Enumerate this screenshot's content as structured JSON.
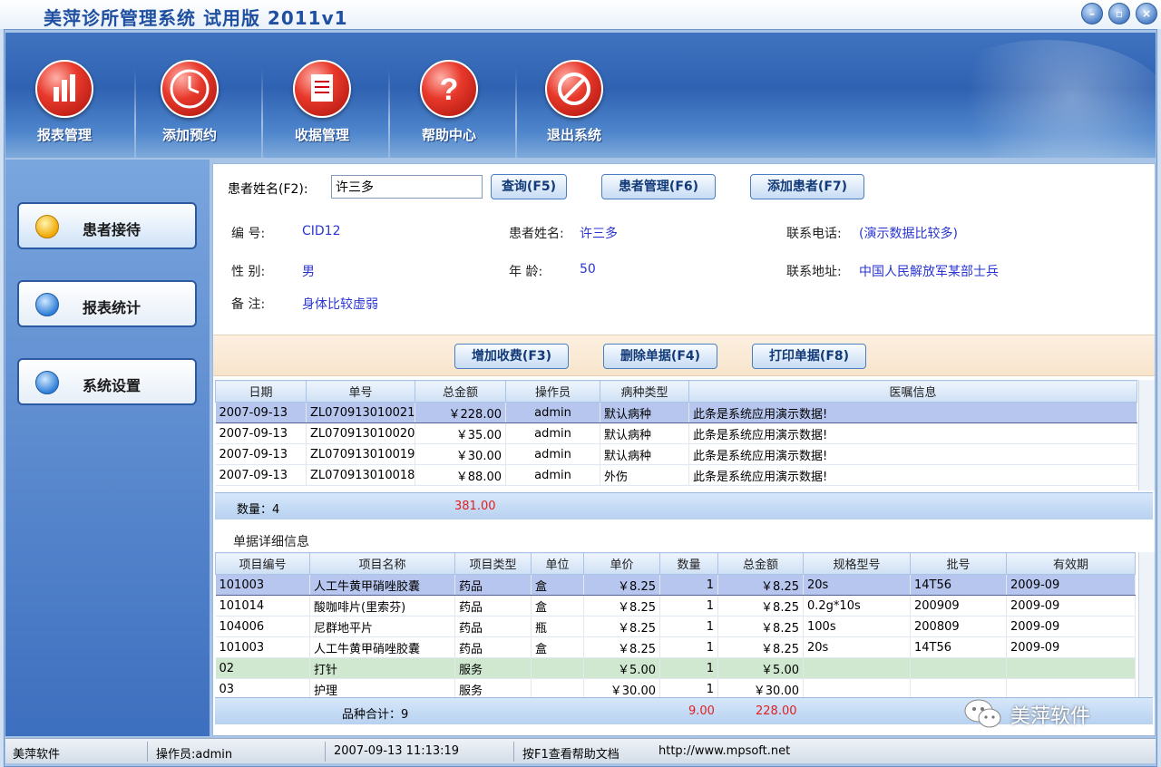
{
  "window": {
    "title": "美萍诊所管理系统 试用版 2011v1",
    "controls": [
      "minimize",
      "restore",
      "close"
    ]
  },
  "toolbar": {
    "items": [
      {
        "label": "报表管理",
        "icon": "chart-icon"
      },
      {
        "label": "添加预约",
        "icon": "clock-icon"
      },
      {
        "label": "收据管理",
        "icon": "document-icon"
      },
      {
        "label": "帮助中心",
        "icon": "help-icon"
      },
      {
        "label": "退出系统",
        "icon": "exit-icon"
      }
    ]
  },
  "sidebar": {
    "items": [
      {
        "label": "患者接待",
        "active": true
      },
      {
        "label": "报表统计",
        "active": false
      },
      {
        "label": "系统设置",
        "active": false
      }
    ]
  },
  "search": {
    "label": "患者姓名(F2):",
    "value": "许三多",
    "query_button": "查询(F5)",
    "manage_button": "患者管理(F6)",
    "add_button": "添加患者(F7)"
  },
  "patient": {
    "id_label": "编 号:",
    "id_value": "CID12",
    "name_label": "患者姓名:",
    "name_value": "许三多",
    "phone_label": "联系电话:",
    "phone_value": "(演示数据比较多)",
    "gender_label": "性 别:",
    "gender_value": "男",
    "age_label": "年 龄:",
    "age_value": "50",
    "address_label": "联系地址:",
    "address_value": "中国人民解放军某部士兵",
    "note_label": "备 注:",
    "note_value": "身体比较虚弱"
  },
  "charge_actions": {
    "add_charge": "增加收费(F3)",
    "delete_receipt": "删除单据(F4)",
    "print_receipt": "打印单据(F8)"
  },
  "receipts": {
    "columns": [
      "日期",
      "单号",
      "总金额",
      "操作员",
      "病种类型",
      "医嘱信息"
    ],
    "rows": [
      [
        "2007-09-13",
        "ZL070913010021",
        "￥228.00",
        "admin",
        "默认病种",
        "此条是系统应用演示数据!"
      ],
      [
        "2007-09-13",
        "ZL070913010020",
        "￥35.00",
        "admin",
        "默认病种",
        "此条是系统应用演示数据!"
      ],
      [
        "2007-09-13",
        "ZL070913010019",
        "￥30.00",
        "admin",
        "默认病种",
        "此条是系统应用演示数据!"
      ],
      [
        "2007-09-13",
        "ZL070913010018",
        "￥88.00",
        "admin",
        "外伤",
        "此条是系统应用演示数据!"
      ]
    ],
    "selected_row": 0,
    "count_label": "数量：4",
    "total": "381.00"
  },
  "details": {
    "section_title": "单据详细信息",
    "columns": [
      "项目编号",
      "项目名称",
      "项目类型",
      "单位",
      "单价",
      "数量",
      "总金额",
      "规格型号",
      "批号",
      "有效期"
    ],
    "rows": [
      [
        "101003",
        "人工牛黄甲硝唑胶囊",
        "药品",
        "盒",
        "￥8.25",
        "1",
        "￥8.25",
        "20s",
        "14T56",
        "2009-09"
      ],
      [
        "101014",
        "酸咖啡片(里索芬)",
        "药品",
        "盒",
        "￥8.25",
        "1",
        "￥8.25",
        "0.2g*10s",
        "200909",
        "2009-09"
      ],
      [
        "104006",
        "尼群地平片",
        "药品",
        "瓶",
        "￥8.25",
        "1",
        "￥8.25",
        "100s",
        "200809",
        "2009-09"
      ],
      [
        "101003",
        "人工牛黄甲硝唑胶囊",
        "药品",
        "盒",
        "￥8.25",
        "1",
        "￥8.25",
        "20s",
        "14T56",
        "2009-09"
      ],
      [
        "02",
        "打针",
        "服务",
        "",
        "￥5.00",
        "1",
        "￥5.00",
        "",
        "",
        ""
      ],
      [
        "03",
        "护理",
        "服务",
        "",
        "￥30.00",
        "1",
        "￥30.00",
        "",
        "",
        ""
      ]
    ],
    "selected_row": 0,
    "green_row": 4,
    "sum_label": "品种合计：9",
    "sum_qty": "9.00",
    "sum_total": "228.00"
  },
  "statusbar": {
    "company": "美萍软件",
    "operator": "操作员:admin",
    "datetime": "2007-09-13 11:13:19",
    "help_hint": "按F1查看帮助文档",
    "url": "http://www.mpsoft.net"
  },
  "watermark": {
    "label": "美萍软件"
  },
  "colors": {
    "toolbar_blue": "#2f62b2",
    "accent_red": "#e8392b",
    "value_blue": "#2a35d0",
    "total_red": "#e02020",
    "selected_row": "#b7c6ee"
  }
}
